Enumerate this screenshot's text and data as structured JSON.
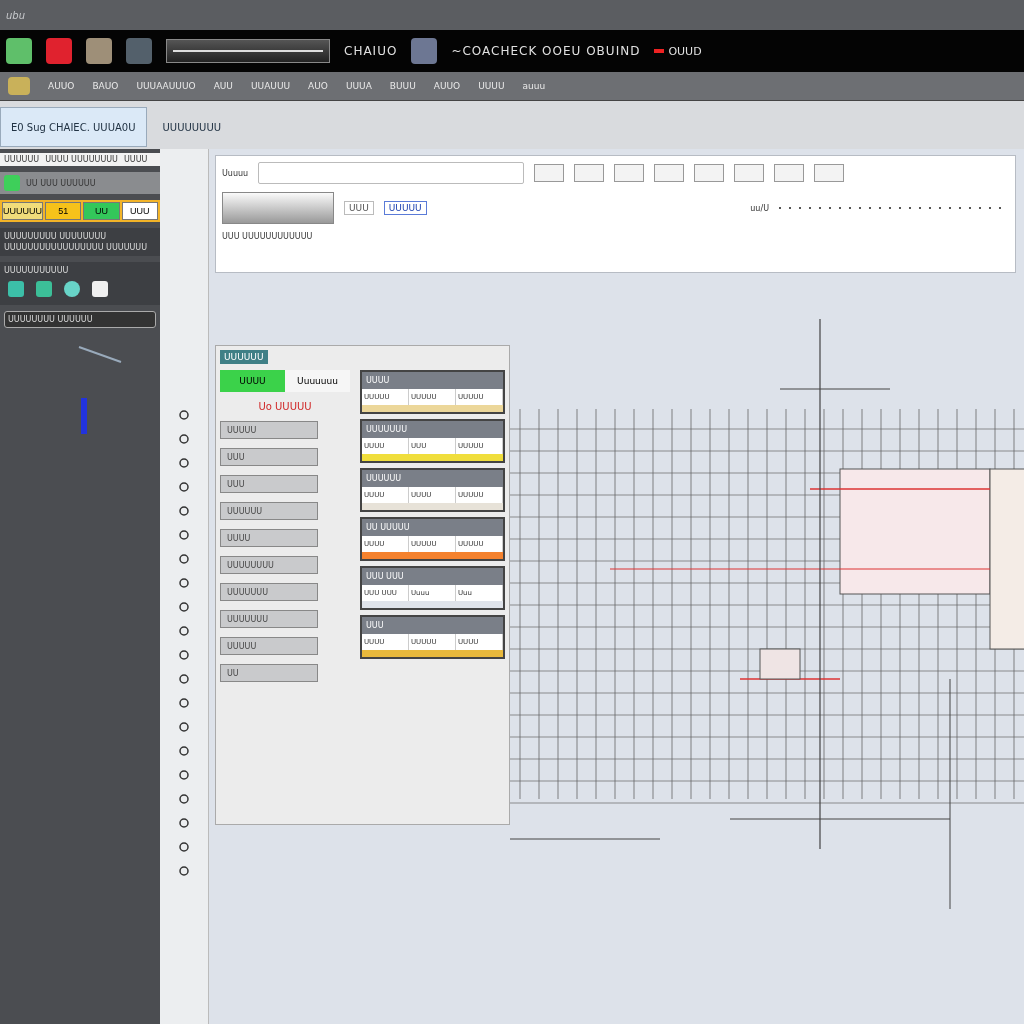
{
  "top_strip": {
    "caption": "ubu"
  },
  "toolbar": {
    "app_name": "CHAIUO",
    "status": "~COACHECK OOEU OBUIND",
    "badge": "OUUD"
  },
  "menu": [
    {
      "label": "AUUO"
    },
    {
      "label": "BAUO"
    },
    {
      "label": "UUUAAUUUO"
    },
    {
      "label": "AUU"
    },
    {
      "label": "UUAUUU"
    },
    {
      "label": "AUO"
    },
    {
      "label": "UUUA"
    },
    {
      "label": "BUUU"
    },
    {
      "label": "AUUO"
    },
    {
      "label": "UUUU"
    },
    {
      "label": "auuu"
    }
  ],
  "document_tabs": [
    {
      "label": "E0 Sug CHAIEC. UUUA0U",
      "selected": true
    },
    {
      "label": "UUUUUUUU",
      "selected": false
    }
  ],
  "left_panel": {
    "header": [
      "UUUUUU",
      "UUUU UUUUUUUU",
      "UUUU"
    ],
    "toolbar_label": "UU UUU UUUUUU",
    "status_buttons": [
      {
        "label": "UUUUUU",
        "color": "#f1dc7a"
      },
      {
        "label": "51",
        "color": "#f6c21a"
      },
      {
        "label": "UU",
        "color": "#33c75a"
      },
      {
        "label": "UUU",
        "color": "#ffffff"
      }
    ],
    "info_lines": [
      "UUUUUUUUU UUUUUUUU",
      "UUUUUUUUUUUUUUUUU UUUUUUU"
    ],
    "layer_label": "UUUUUUUUUUU",
    "layer_field": "UUUUUUUU UUUUUU"
  },
  "top_panel": {
    "field_label": "Uuuuu",
    "ruler_label": "uu/U",
    "sub_tabs": [
      {
        "label": "UUU",
        "selected": false
      },
      {
        "label": "UUUUU",
        "selected": true
      }
    ],
    "sub_row": "UUU UUUUUUUUUUUU"
  },
  "float_panel": {
    "title": "UUUUUU",
    "tabs": [
      {
        "label": "UUUU",
        "selected": true
      },
      {
        "label": "Uuuuuuu",
        "selected": false
      }
    ],
    "heading": "Uo UUUUU",
    "fields": [
      "UUUUU",
      "UUU",
      "UUU",
      "UUUUUU",
      "UUUU",
      "UUUUUUUU",
      "UUUUUUU",
      "UUUUUUU",
      "UUUUU",
      "UU"
    ],
    "groups": [
      {
        "header": "UUUU",
        "cells": [
          "UUUUU",
          "UUUUU",
          "UUUUU"
        ],
        "color": "#ecd79a"
      },
      {
        "header": "UUUUUUU",
        "cells": [
          "UUUU",
          "UUU",
          "UUUUU"
        ],
        "color": "#f0de3c"
      },
      {
        "header": "UUUUUU",
        "cells": [
          "UUUU",
          "UUUU",
          "UUUUU"
        ],
        "color": "#e7e2d8"
      },
      {
        "header": "UU UUUUU",
        "cells": [
          "UUUU",
          "UUUUU",
          "UUUUU"
        ],
        "color": "#f5822e"
      },
      {
        "header": "UUU UUU",
        "cells": [
          "UUU UUU",
          "Uuuu",
          "Uuu"
        ],
        "color": "#dfe3ea"
      },
      {
        "header": "UUU",
        "cells": [
          "UUUU",
          "UUUUU",
          "UUUU"
        ],
        "color": "#e9b93c"
      }
    ]
  }
}
